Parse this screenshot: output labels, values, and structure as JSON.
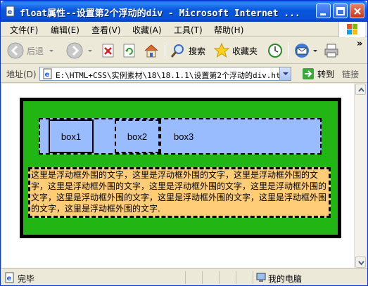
{
  "window": {
    "title": "float属性--设置第2个浮动的div - Microsoft Internet ..."
  },
  "menu": [
    "文件(F)",
    "编辑(E)",
    "查看(V)",
    "收藏(A)",
    "工具(T)",
    "帮助(H)"
  ],
  "toolbar": {
    "back_label": "后退",
    "search_label": "搜索",
    "favorites_label": "收藏夹",
    "more": "»"
  },
  "address": {
    "label": "地址(D)",
    "value": "E:\\HTML+CSS\\实例素材\\18\\18.1.1\\设置第2个浮动的div.htm",
    "go_label": "转到",
    "links_label": "链接"
  },
  "page": {
    "box1": "box1",
    "box2": "box2",
    "box3": "box3",
    "paragraph": "这里是浮动框外围的文字，这里是浮动框外围的文字，这里是浮动框外围的文字，这里是浮动框外围的文字，这里是浮动框外围的文字，这里是浮动框外围的文字，这里是浮动框外围的文字，这里是浮动框外围的文字，这里是浮动框外围的文字，这里是浮动框外围的文字."
  },
  "status": {
    "text": "完毕",
    "zone": "我的电脑"
  },
  "colors": {
    "outer_bg": "#22b615",
    "row_bg": "#99bbff",
    "para_bg": "#ffcc77",
    "titlebar": "#0855dd"
  }
}
